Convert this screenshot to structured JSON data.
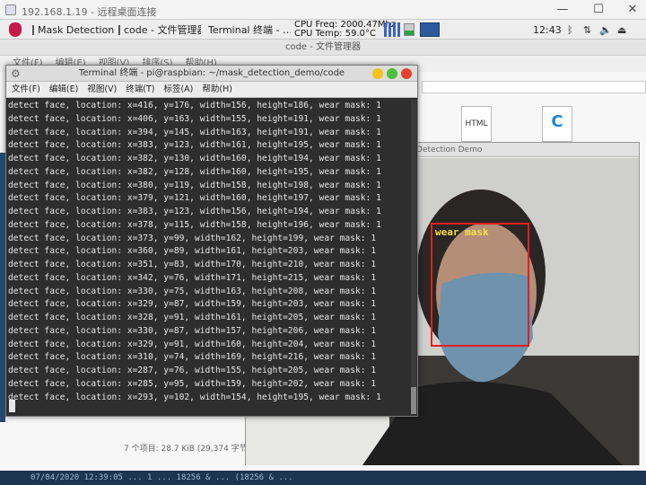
{
  "rdp": {
    "title": "192.168.1.19 - 远程桌面连接",
    "minimize": "—",
    "maximize": "☐",
    "close": "✕"
  },
  "panel": {
    "tasks": [
      {
        "label": "Mask Detection…"
      },
      {
        "label": "code - 文件管理器"
      },
      {
        "label": "Terminal 终端 - …"
      }
    ],
    "cpu_freq": "CPU Freq: 2000.47Mhz",
    "cpu_temp": "CPU Temp: 59.0°C",
    "clock": "12:43",
    "accent": "#3a63c4"
  },
  "file_manager": {
    "title": "code - 文件管理器",
    "menu": [
      "文件(F)",
      "编辑(E)",
      "视图(V)",
      "排序(S)",
      "帮助(H)"
    ],
    "files": [
      {
        "type": "settings",
        "label": ""
      },
      {
        "type": "html",
        "label": "HTML"
      },
      {
        "type": "c-source",
        "label": "C"
      }
    ],
    "status": "7 个项目: 28.7 KiB (29,374 字节)"
  },
  "mask_window": {
    "title": "Mask Detection Demo",
    "detection_label": "wear mask",
    "box_color": "#e02020"
  },
  "terminal": {
    "title": "Terminal 终端 - pi@raspbian: ~/mask_detection_demo/code",
    "menu": [
      "文件(F)",
      "编辑(E)",
      "视图(V)",
      "终端(T)",
      "标签(A)",
      "帮助(H)"
    ],
    "lines": [
      "detect face, location: x=416, y=176, width=156, height=186, wear mask: 1",
      "detect face, location: x=406, y=163, width=155, height=191, wear mask: 1",
      "detect face, location: x=394, y=145, width=163, height=191, wear mask: 1",
      "detect face, location: x=383, y=123, width=161, height=195, wear mask: 1",
      "detect face, location: x=382, y=130, width=160, height=194, wear mask: 1",
      "detect face, location: x=382, y=128, width=160, height=195, wear mask: 1",
      "detect face, location: x=380, y=119, width=158, height=198, wear mask: 1",
      "detect face, location: x=379, y=121, width=160, height=197, wear mask: 1",
      "detect face, location: x=383, y=123, width=156, height=194, wear mask: 1",
      "detect face, location: x=378, y=115, width=158, height=196, wear mask: 1",
      "detect face, location: x=373, y=99, width=162, height=199, wear mask: 1",
      "detect face, location: x=360, y=89, width=161, height=203, wear mask: 1",
      "detect face, location: x=351, y=83, width=170, height=210, wear mask: 1",
      "detect face, location: x=342, y=76, width=171, height=215, wear mask: 1",
      "detect face, location: x=330, y=75, width=163, height=208, wear mask: 1",
      "detect face, location: x=329, y=87, width=159, height=203, wear mask: 1",
      "detect face, location: x=328, y=91, width=161, height=205, wear mask: 1",
      "detect face, location: x=330, y=87, width=157, height=206, wear mask: 1",
      "detect face, location: x=329, y=91, width=160, height=204, wear mask: 1",
      "detect face, location: x=310, y=74, width=169, height=216, wear mask: 1",
      "detect face, location: x=287, y=76, width=155, height=205, wear mask: 1",
      "detect face, location: x=285, y=95, width=159, height=202, wear mask: 1",
      "detect face, location: x=293, y=102, width=154, height=195, wear mask: 1"
    ]
  },
  "bottom_text": "07/04/2020 12:39:05 ... 1 ... 18256 & ... (18256 & ..."
}
